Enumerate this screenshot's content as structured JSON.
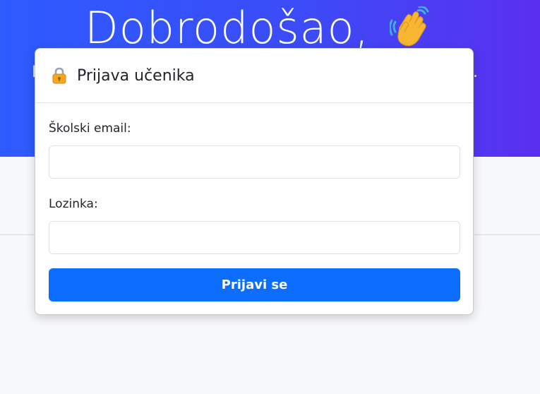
{
  "hero": {
    "title": "Dobrodošao,",
    "subtitle_left": "P",
    "subtitle_right": "."
  },
  "modal": {
    "icon": "lock-icon",
    "title": "Prijava učenika",
    "email_label": "Školski email:",
    "email_value": "",
    "password_label": "Lozinka:",
    "password_value": "",
    "submit_label": "Prijavi se"
  },
  "colors": {
    "primary": "#0d6efd",
    "hero_start": "#2d5bff",
    "hero_end": "#5b2ff0"
  }
}
